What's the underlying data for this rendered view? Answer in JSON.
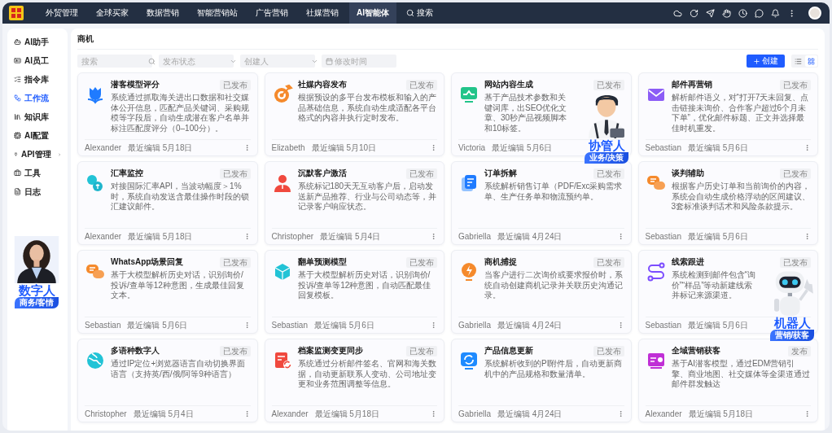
{
  "nav": {
    "menu": [
      {
        "label": "外贸管理",
        "selected": false
      },
      {
        "label": "全球买家",
        "selected": false
      },
      {
        "label": "数据营销",
        "selected": false
      },
      {
        "label": "智能营销站",
        "selected": false
      },
      {
        "label": "广告营销",
        "selected": false
      },
      {
        "label": "社媒营销",
        "selected": false
      },
      {
        "label": "AI智能体",
        "selected": true
      }
    ],
    "search": {
      "label": "搜索"
    }
  },
  "sidebar": {
    "items": [
      {
        "label": "AI助手",
        "selected": false,
        "has_submenu": false
      },
      {
        "label": "AI员工",
        "selected": false,
        "has_submenu": false
      },
      {
        "label": "指令库",
        "selected": false,
        "has_submenu": false
      },
      {
        "label": "工作流",
        "selected": true,
        "has_submenu": false
      },
      {
        "label": "知识库",
        "selected": false,
        "has_submenu": false
      },
      {
        "label": "AI配置",
        "selected": false,
        "has_submenu": false
      },
      {
        "label": "API管理",
        "selected": false,
        "has_submenu": true
      },
      {
        "label": "工具",
        "selected": false,
        "has_submenu": false
      },
      {
        "label": "日志",
        "selected": false,
        "has_submenu": false
      }
    ]
  },
  "page": {
    "title": "商机",
    "filters": [
      {
        "kind": "search",
        "placeholder": "搜索"
      },
      {
        "kind": "select",
        "placeholder": "发布状态"
      },
      {
        "kind": "select",
        "placeholder": "创建人"
      },
      {
        "kind": "date",
        "placeholder": "修改时间"
      }
    ],
    "create_button": "创建",
    "view_toggle": [
      {
        "kind": "list",
        "selected": false
      },
      {
        "kind": "grid",
        "selected": true
      }
    ]
  },
  "cards": [
    {
      "title": "潜客模型评分",
      "status": "已发布",
      "description": "系统通过抓取海关进出口数据和社交媒体公开信息，匹配产品关键词、采购规模等字段后，自动生成潜在客户名单并标注匹配度评分（0–100分）。",
      "author": "Alexander",
      "edited": "最近编辑 5月18日"
    },
    {
      "title": "社媒内容发布",
      "status": "已发布",
      "description": "根据预设的多平台发布模板和输入的产品基础信息，系统自动生成适配各平台格式的内容并执行定时发布。",
      "author": "Elizabeth",
      "edited": "最近编辑 5月10日"
    },
    {
      "title": "网站内容生成",
      "status": "已发布",
      "description": "基于产品技术参数和关键词库，出SEO优化文章、30秒产品视频脚本和10标签。",
      "author": "Victoria",
      "edited": "最近编辑 5月6日"
    },
    {
      "title": "邮件再营销",
      "status": "已发布",
      "description": "解析邮件语义，对“打开7天未回复、点击链接未询价、合作客户超过6个月未下单”，优化邮件标题、正文并选择最佳时机重发。",
      "author": "Sebastian",
      "edited": "最近编辑 5月6日"
    },
    {
      "title": "汇率监控",
      "status": "已发布",
      "description": "对接国际汇率API，当波动幅度＞1%时，系统自动发送含最佳操作时段的锁汇建议邮件。",
      "author": "Alexander",
      "edited": "最近编辑 5月18日"
    },
    {
      "title": "沉默客户激活",
      "status": "已发布",
      "description": "系统标记180天无互动客户后，启动发送新产品推荐、行业与公司动态等，并记录客户响应状态。",
      "author": "Christopher",
      "edited": "最近编辑 5月4日"
    },
    {
      "title": "订单拆解",
      "status": "已发布",
      "description": "系统解析销售订单（PDF/Exc采购需求单、生产任务单和物流预约单。",
      "author": "Gabriella",
      "edited": "最近编辑 4月24日"
    },
    {
      "title": "谈判辅助",
      "status": "已发布",
      "description": "根据客户历史订单和当前询价的内容，系统会自动生成价格浮动的区间建议、3套标准谈判话术和风险条款提示。",
      "author": "Sebastian",
      "edited": "最近编辑 5月6日"
    },
    {
      "title": "WhatsApp场景回复",
      "status": "已发布",
      "description": "基于大模型解析历史对话，识别询价/投诉/查单等12种意图，生成最佳回复文本。",
      "author": "Sebastian",
      "edited": "最近编辑 5月6日"
    },
    {
      "title": "翻单预测模型",
      "status": "已发布",
      "description": "基于大模型解析历史对话，识别询价/投诉/查单等12种意图，自动匹配最佳回复模板。",
      "author": "Sebastian",
      "edited": "最近编辑 5月6日"
    },
    {
      "title": "商机捕捉",
      "status": "已发布",
      "description": "当客户进行二次询价或要求报价时，系统自动创建商机记录并关联历史沟通记录。",
      "author": "Gabriella",
      "edited": "最近编辑 4月24日"
    },
    {
      "title": "线索跟进",
      "status": "已发布",
      "description": "系统检测到邮件包含“询价”“样品”等动新建线索并标记来源渠道。",
      "author": "Sebastian",
      "edited": "最近编辑 5月6日"
    },
    {
      "title": "多语种数字人",
      "status": "已发布",
      "description": "通过IP定位+浏览器语言自动切换界面语言（支持英/西/俄/阿等9种语言）",
      "author": "Christopher",
      "edited": "最近编辑 5月4日"
    },
    {
      "title": "档案监测变更同步",
      "status": "已发布",
      "description": "系统通过分析邮件签名、官网和海关数据，自动更新联系人变动、公司地址变更和业务范围调整等信息。",
      "author": "Alexander",
      "edited": "最近编辑 5月18日"
    },
    {
      "title": "产品信息更新",
      "status": "已发布",
      "description": "系统解析收到的PI附件后，自动更新商机中的产品规格和数量清单。",
      "author": "Gabriella",
      "edited": "最近编辑 4月24日"
    },
    {
      "title": "全域营销获客",
      "status": "发布",
      "description": "基于AI潜客模型，通过EDM营销引擎、商业地图、社交媒体等全渠道通过邮件群发触达",
      "author": "Alexander",
      "edited": "最近编辑 5月18日"
    }
  ],
  "overlays": [
    {
      "title": "数字人",
      "tag": "商务/客情"
    },
    {
      "kind": "cartoon",
      "title": "协管人",
      "tag": "业务/决策"
    },
    {
      "kind": "robot",
      "title": "机器人",
      "tag": "营销/获客"
    }
  ]
}
